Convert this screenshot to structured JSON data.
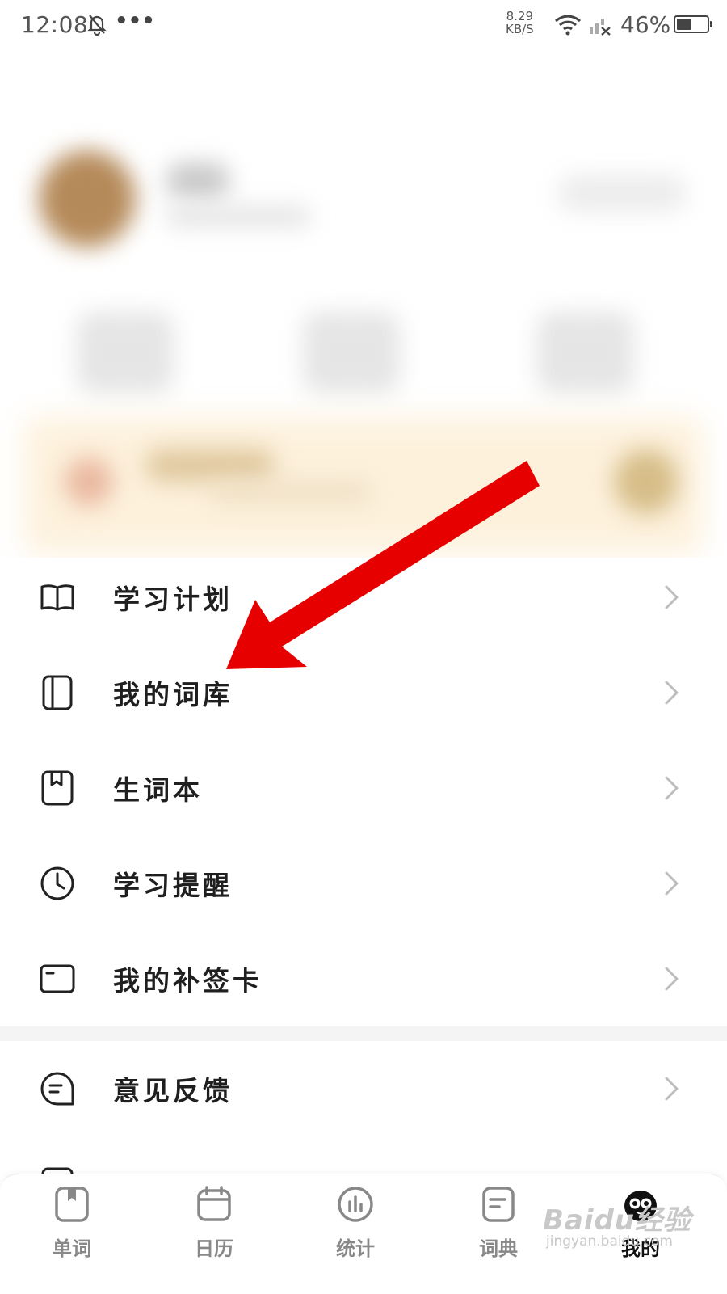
{
  "status_bar": {
    "time": "12:08",
    "dots": "•••",
    "speed_value": "8.29",
    "speed_unit": "KB/S",
    "battery_text": "46%"
  },
  "menu_group_1": [
    {
      "label": "学习计划",
      "icon": "book-open-icon"
    },
    {
      "label": "我的词库",
      "icon": "wordbank-icon"
    },
    {
      "label": "生词本",
      "icon": "notebook-icon"
    },
    {
      "label": "学习提醒",
      "icon": "clock-icon"
    },
    {
      "label": "我的补签卡",
      "icon": "card-icon"
    }
  ],
  "menu_group_2": [
    {
      "label": "意见反馈",
      "icon": "feedback-icon"
    }
  ],
  "tabbar": {
    "tabs": [
      {
        "label": "单词",
        "icon": "word-tab-icon",
        "active": false
      },
      {
        "label": "日历",
        "icon": "calendar-tab-icon",
        "active": false
      },
      {
        "label": "统计",
        "icon": "stats-tab-icon",
        "active": false
      },
      {
        "label": "词典",
        "icon": "dictionary-tab-icon",
        "active": false
      },
      {
        "label": "我的",
        "icon": "mascot-tab-icon",
        "active": true
      }
    ]
  },
  "watermark": {
    "text": "Baidu经验",
    "sub": "jingyan.baidu.com"
  },
  "colors": {
    "annotation_arrow": "#e60000",
    "vip_banner": "#fdf1dc",
    "divider": "#f4f4f4"
  }
}
